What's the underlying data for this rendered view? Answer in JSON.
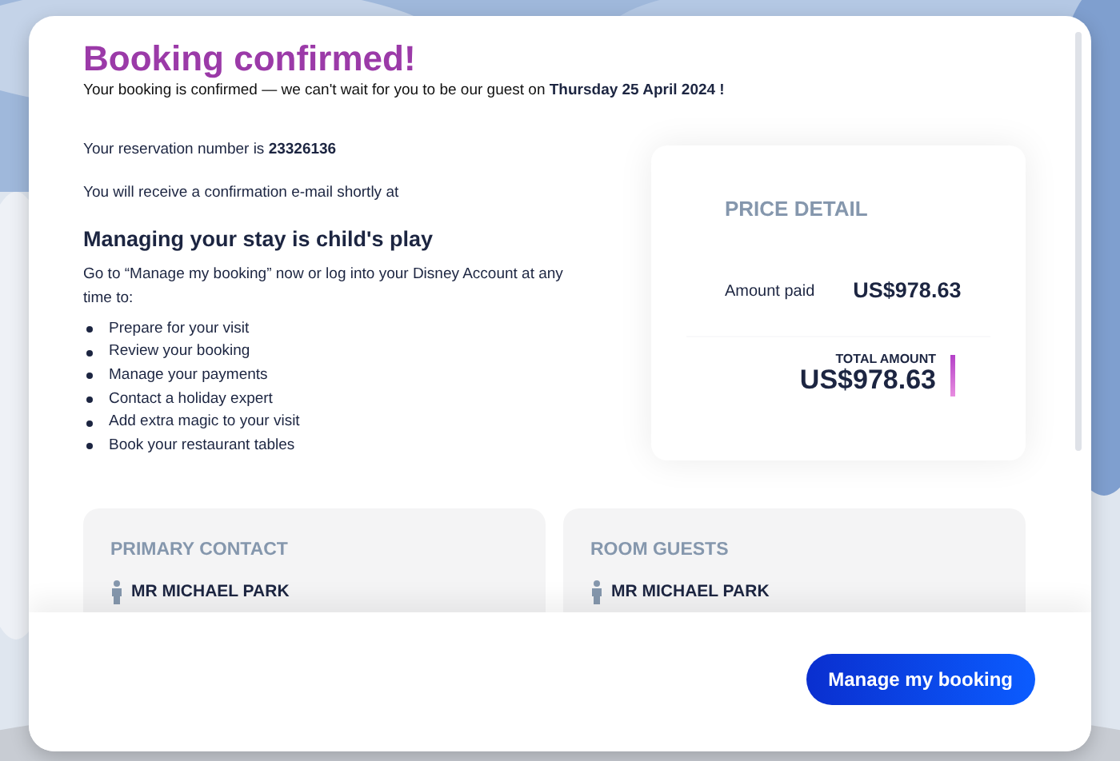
{
  "title": "Booking confirmed!",
  "subtitle": "Your booking is confirmed — we can't wait for you to be our guest on **Thursday 25 April 2024 !**",
  "reservation": "Your reservation number is **23326136**",
  "email_notice": "You will receive a confirmation e-mail shortly at",
  "manage": {
    "heading": "Managing your stay is child's play",
    "intro": "Go to “Manage my booking” now or log into your Disney Account at any time to:",
    "items": [
      "Prepare for your visit",
      "Review your booking",
      "Manage your payments",
      "Contact a holiday expert",
      "Add extra magic to your visit",
      "Book your restaurant tables"
    ]
  },
  "price_detail": {
    "title": "PRICE DETAIL",
    "rows": [
      {
        "label": "Amount paid",
        "value": "US$978.63"
      }
    ],
    "total_label": "TOTAL AMOUNT",
    "total_value": "US$978.63"
  },
  "contacts": [
    {
      "title": "PRIMARY CONTACT",
      "guests": [
        "MR MICHAEL PARK"
      ]
    },
    {
      "title": "ROOM GUESTS",
      "guests": [
        "MR MICHAEL PARK"
      ]
    }
  ],
  "footer": {
    "button": "Manage my booking"
  }
}
